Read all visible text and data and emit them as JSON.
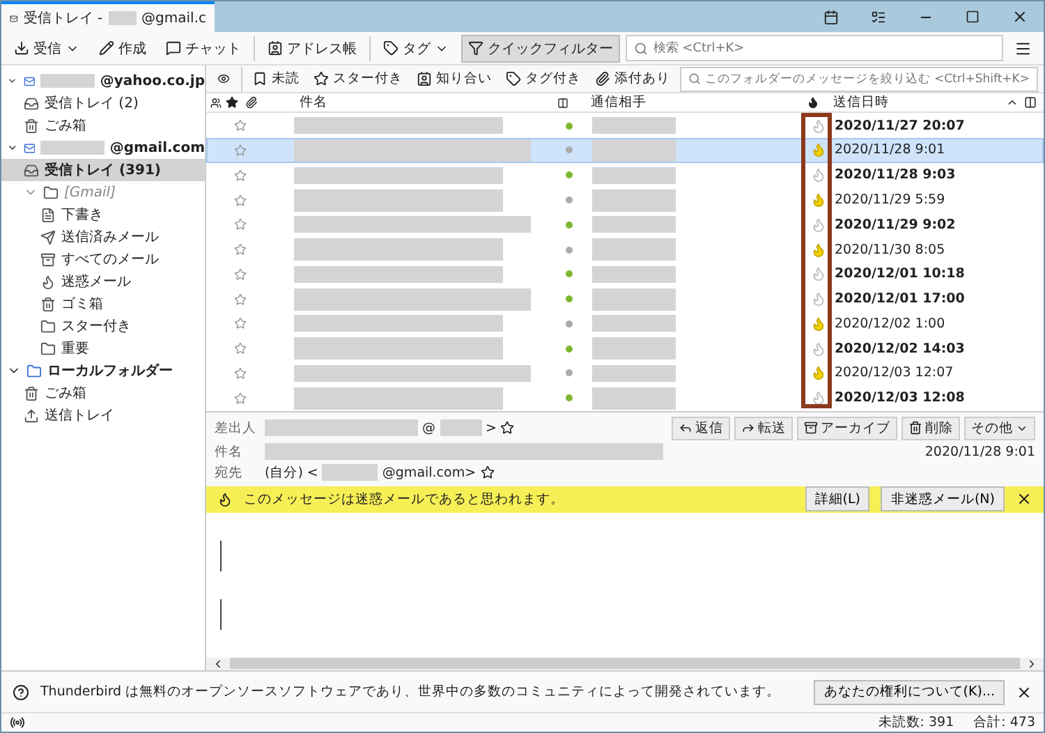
{
  "window": {
    "tab_title": "受信トレイ - ",
    "tab_suffix": "@gmail.c"
  },
  "toolbar": {
    "buttons": [
      {
        "label": "受信",
        "kind": "get",
        "menu": true
      },
      {
        "label": "作成",
        "kind": "write",
        "menu": false
      },
      {
        "label": "チャット",
        "kind": "chat",
        "menu": false
      },
      {
        "label": "アドレス帳",
        "kind": "contacts",
        "menu": false
      },
      {
        "label": "タグ",
        "kind": "tag",
        "menu": true
      },
      {
        "label": "クイックフィルター",
        "kind": "filter",
        "menu": false,
        "selected": true
      }
    ],
    "search": {
      "placeholder": "検索 <Ctrl+K>"
    }
  },
  "folders": [
    {
      "label": "@yahoo.co.jp",
      "kind": "account",
      "expanded": true,
      "selected": false,
      "children": [
        {
          "label": "受信トレイ (2)",
          "kind": "inbox",
          "selected": false
        },
        {
          "label": "ごみ箱",
          "kind": "trash",
          "selected": false
        }
      ]
    },
    {
      "label": "@gmail.com",
      "kind": "account",
      "expanded": true,
      "selected": false,
      "children": [
        {
          "label": "受信トレイ (391)",
          "kind": "inbox",
          "selected": true
        },
        {
          "label": "[Gmail]",
          "kind": "virtual",
          "expanded": true,
          "selected": false,
          "children": [
            {
              "label": "下書き",
              "kind": "drafts",
              "selected": false
            },
            {
              "label": "送信済みメール",
              "kind": "sent",
              "selected": false
            },
            {
              "label": "すべてのメール",
              "kind": "archive",
              "selected": false
            },
            {
              "label": "迷惑メール",
              "kind": "junk",
              "selected": false
            },
            {
              "label": "ゴミ箱",
              "kind": "trash",
              "selected": false
            },
            {
              "label": "スター付き",
              "kind": "folder",
              "selected": false
            },
            {
              "label": "重要",
              "kind": "folder",
              "selected": false
            }
          ]
        }
      ]
    },
    {
      "label": "ローカルフォルダー",
      "kind": "local",
      "expanded": true,
      "selected": false,
      "children": [
        {
          "label": "ごみ箱",
          "kind": "trash",
          "selected": false
        },
        {
          "label": "送信トレイ",
          "kind": "outbox",
          "selected": false
        }
      ]
    }
  ],
  "quick_filter": {
    "buttons": [
      {
        "label": "未読",
        "kind": "unread"
      },
      {
        "label": "スター付き",
        "kind": "star"
      },
      {
        "label": "知り合い",
        "kind": "contact"
      },
      {
        "label": "タグ付き",
        "kind": "tag"
      },
      {
        "label": "添付あり",
        "kind": "attach"
      }
    ],
    "placeholder": "このフォルダーのメッセージを絞り込む <Ctrl+Shift+K>"
  },
  "columns": {
    "subject": "件名",
    "correspondent": "通信相手",
    "date": "送信日時"
  },
  "messages": [
    {
      "date": "2020/11/27 20:07",
      "unread": true,
      "junk": false,
      "selected": false
    },
    {
      "date": "2020/11/28 9:01",
      "unread": false,
      "junk": true,
      "selected": true
    },
    {
      "date": "2020/11/28 9:03",
      "unread": true,
      "junk": false,
      "selected": false
    },
    {
      "date": "2020/11/29 5:59",
      "unread": false,
      "junk": true,
      "selected": false
    },
    {
      "date": "2020/11/29 9:02",
      "unread": true,
      "junk": false,
      "selected": false
    },
    {
      "date": "2020/11/30 8:05",
      "unread": false,
      "junk": true,
      "selected": false
    },
    {
      "date": "2020/12/01 10:18",
      "unread": true,
      "junk": false,
      "selected": false
    },
    {
      "date": "2020/12/01 17:00",
      "unread": true,
      "junk": false,
      "selected": false
    },
    {
      "date": "2020/12/02 1:00",
      "unread": false,
      "junk": true,
      "selected": false
    },
    {
      "date": "2020/12/02 14:03",
      "unread": true,
      "junk": false,
      "selected": false
    },
    {
      "date": "2020/12/03 12:07",
      "unread": false,
      "junk": true,
      "selected": false
    },
    {
      "date": "2020/12/03 12:08",
      "unread": true,
      "junk": false,
      "selected": false
    }
  ],
  "header": {
    "from_label": "差出人",
    "from_at": "@",
    "from_end": ">",
    "subject_label": "件名",
    "date": "2020/11/28 9:01",
    "to_label": "宛先",
    "to_value": "(自分) <",
    "to_suffix": "@gmail.com>",
    "actions": [
      {
        "label": "返信",
        "kind": "reply"
      },
      {
        "label": "転送",
        "kind": "forward"
      },
      {
        "label": "アーカイブ",
        "kind": "archive"
      },
      {
        "label": "削除",
        "kind": "delete"
      },
      {
        "label": "その他",
        "kind": "more"
      }
    ]
  },
  "junk_bar": {
    "message": "このメッセージは迷惑メールであると思われます。",
    "buttons": [
      "詳細(L)",
      "非迷惑メール(N)"
    ]
  },
  "notification": {
    "message": "Thunderbird は無料のオープンソースソフトウェアであり、世界中の多数のコミュニティによって開発されています。",
    "button": "あなたの権利について(K)..."
  },
  "status_bar": {
    "unread": "未読数: 391",
    "total": "合計: 473"
  }
}
